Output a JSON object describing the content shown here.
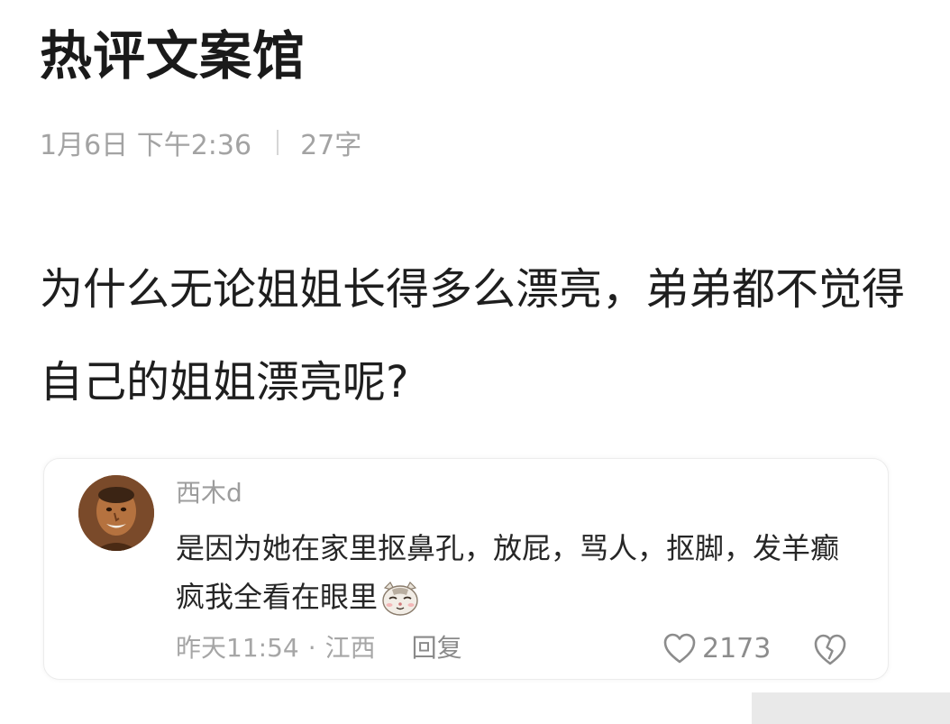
{
  "header": {
    "title": "热评文案馆"
  },
  "meta": {
    "date": "1月6日 下午2:36",
    "word_count": "27字"
  },
  "post": {
    "text": "为什么无论姐姐长得多么漂亮，弟弟都不觉得自己的姐姐漂亮呢?"
  },
  "comment": {
    "username": "西木d",
    "text": "是因为她在家里抠鼻孔，放屁，骂人，抠脚，发羊癫疯我全看在眼里",
    "time": "昨天11:54",
    "separator": "·",
    "location": "江西",
    "reply_label": "回复",
    "like_count": "2173",
    "avatar_icon": "person-avatar",
    "emoji_icon": "smirking-cat-emoji",
    "like_icon": "heart-outline-icon",
    "dislike_icon": "broken-heart-icon"
  },
  "colors": {
    "title": "#1a1a1a",
    "meta": "#a3a3a3",
    "body_text": "#1e1e1e",
    "comment_text": "#262626",
    "muted": "#a6a6a6"
  }
}
